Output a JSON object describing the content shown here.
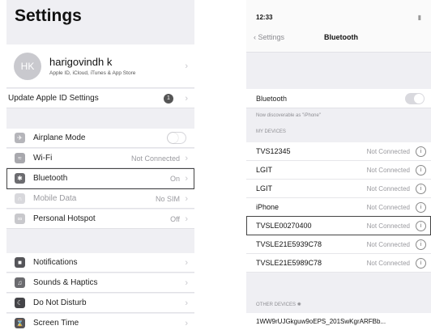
{
  "settings": {
    "title": "Settings",
    "profile": {
      "initials": "HK",
      "name": "harigovindh k",
      "subtitle": "Apple ID, iCloud, iTunes & App Store"
    },
    "update_apple_id": {
      "label": "Update Apple ID Settings",
      "badge": "1"
    },
    "items": [
      {
        "label": "Airplane Mode",
        "value": "",
        "icon": "airplane-icon",
        "color": "#b5b5ba"
      },
      {
        "label": "Wi-Fi",
        "value": "Not Connected",
        "icon": "wifi-icon",
        "color": "#a8a8ad"
      },
      {
        "label": "Bluetooth",
        "value": "On",
        "icon": "bluetooth-icon",
        "color": "#6c6c70"
      },
      {
        "label": "Mobile Data",
        "value": "No SIM",
        "icon": "antenna-icon",
        "color": "#d8d8dc"
      },
      {
        "label": "Personal Hotspot",
        "value": "Off",
        "icon": "hotspot-icon",
        "color": "#c8c8cc"
      }
    ],
    "items2": [
      {
        "label": "Notifications",
        "icon": "notifications-icon",
        "color": "#555559"
      },
      {
        "label": "Sounds & Haptics",
        "icon": "speaker-icon",
        "color": "#6b6b6f"
      },
      {
        "label": "Do Not Disturb",
        "icon": "moon-icon",
        "color": "#444448"
      },
      {
        "label": "Screen Time",
        "icon": "hourglass-icon",
        "color": "#555559"
      }
    ]
  },
  "bluetooth": {
    "time": "12:33",
    "back_label": "Settings",
    "title": "Bluetooth",
    "toggle_label": "Bluetooth",
    "discoverable": "Now discoverable as \"iPhone\"",
    "my_devices_header": "MY DEVICES",
    "devices": [
      {
        "name": "TVS12345",
        "status": "Not Connected"
      },
      {
        "name": "LGIT",
        "status": "Not Connected"
      },
      {
        "name": "LGIT",
        "status": "Not Connected"
      },
      {
        "name": "iPhone",
        "status": "Not Connected"
      },
      {
        "name": "TVSLE00270400",
        "status": "Not Connected"
      },
      {
        "name": "TVSLE21E5939C78",
        "status": "Not Connected"
      },
      {
        "name": "TVSLE21E5989C78",
        "status": "Not Connected"
      }
    ],
    "other_devices_header": "OTHER DEVICES",
    "other_device": "1WW9rUJGkguw9oEPS_201SwKgrARFBb..."
  }
}
